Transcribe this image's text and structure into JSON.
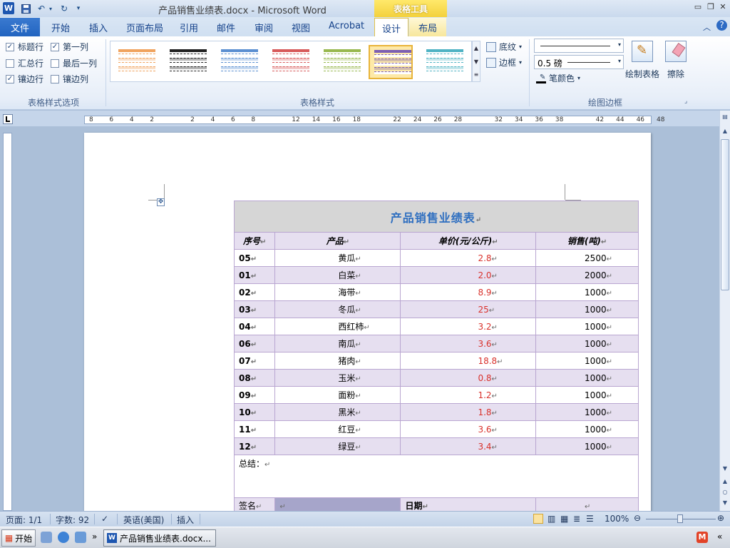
{
  "titlebar": {
    "title": "产品销售业绩表.docx - Microsoft Word",
    "context_group": "表格工具",
    "logo": "W"
  },
  "tabs": {
    "file": "文件",
    "home": "开始",
    "insert": "插入",
    "layout_page": "页面布局",
    "references": "引用",
    "mailings": "邮件",
    "review": "审阅",
    "view": "视图",
    "acrobat": "Acrobat",
    "design": "设计",
    "layout": "布局"
  },
  "options": {
    "header_row": "标题行",
    "first_col": "第一列",
    "total_row": "汇总行",
    "last_col": "最后一列",
    "banded_rows": "镶边行",
    "banded_cols": "镶边列",
    "checked": "✓",
    "group_label": "表格样式选项"
  },
  "styles": {
    "group_label": "表格样式",
    "shading": "底纹",
    "borders": "边框"
  },
  "drawing": {
    "line_weight": "0.5 磅",
    "pen_color": "笔颜色",
    "draw_table": "绘制表格",
    "eraser": "擦除",
    "group_label": "绘图边框"
  },
  "colors": {
    "style1": "#f0a35e",
    "style2": "#222222",
    "style3": "#5b8fd1",
    "style4": "#d75a5a",
    "style5": "#98b84f",
    "style6": "#7c5fb3",
    "style7": "#4fb3c4"
  },
  "ruler": {
    "labels": [
      "8",
      "6",
      "4",
      "2",
      "2",
      "4",
      "6",
      "8",
      "12",
      "14",
      "16",
      "18",
      "22",
      "24",
      "26",
      "28",
      "32",
      "34",
      "36",
      "38",
      "42",
      "44",
      "46",
      "48"
    ]
  },
  "table": {
    "title": "产品销售业绩表",
    "headers": [
      "序号",
      "产品",
      "单价(元/公斤)",
      "销售(吨)"
    ],
    "rows": [
      [
        "05",
        "黄瓜",
        "2.8",
        "2500"
      ],
      [
        "01",
        "白菜",
        "2.0",
        "2000"
      ],
      [
        "02",
        "海带",
        "8.9",
        "1000"
      ],
      [
        "03",
        "冬瓜",
        "25",
        "1000"
      ],
      [
        "04",
        "西红柿",
        "3.2",
        "1000"
      ],
      [
        "06",
        "南瓜",
        "3.6",
        "1000"
      ],
      [
        "07",
        "猪肉",
        "18.8",
        "1000"
      ],
      [
        "08",
        "玉米",
        "0.8",
        "1000"
      ],
      [
        "09",
        "面粉",
        "1.2",
        "1000"
      ],
      [
        "10",
        "黑米",
        "1.8",
        "1000"
      ],
      [
        "11",
        "红豆",
        "3.6",
        "1000"
      ],
      [
        "12",
        "绿豆",
        "3.4",
        "1000"
      ]
    ],
    "summary": "总结：",
    "sign": "签名",
    "date": "日期",
    "mark": "↵"
  },
  "status": {
    "page": "页面: 1/1",
    "words": "字数: 92",
    "language": "英语(美国)",
    "mode": "插入",
    "zoom": "100%"
  },
  "taskbar": {
    "start": "开始",
    "item": "产品销售业绩表.docx..."
  }
}
